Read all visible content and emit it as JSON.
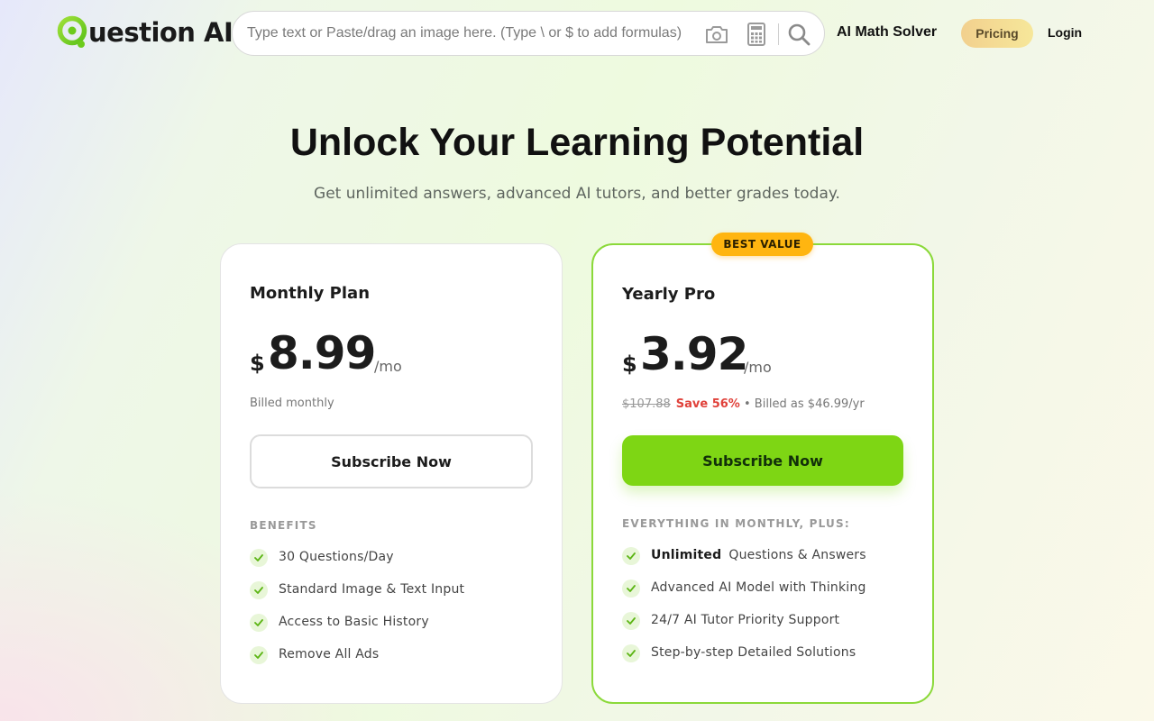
{
  "brand": {
    "logo_text": "uestion AI",
    "accent": "#7ed614"
  },
  "search": {
    "placeholder": "Type text or Paste/drag an image here. (Type \\ or $ to add formulas)",
    "icons": [
      "camera-icon",
      "calculator-icon",
      "search-icon"
    ]
  },
  "nav": {
    "solver": "AI Math Solver",
    "pricing": "Pricing",
    "login": "Login"
  },
  "hero": {
    "title": "Unlock Your Learning Potential",
    "subtitle": "Get unlimited answers, advanced AI tutors, and better grades today."
  },
  "plans": {
    "monthly": {
      "name": "Monthly Plan",
      "currency": "$",
      "amount": "8.99",
      "period": "/mo",
      "billed": "Billed monthly",
      "cta": "Subscribe Now",
      "features_heading": "BENEFITS",
      "features": [
        {
          "text": "30 Questions/Day"
        },
        {
          "text": "Standard Image & Text Input"
        },
        {
          "text": "Access to Basic History"
        },
        {
          "text": "Remove All Ads"
        }
      ]
    },
    "yearly": {
      "badge": "BEST VALUE",
      "name": "Yearly Pro",
      "currency": "$",
      "amount": "3.92",
      "period": "/mo",
      "original_price": "$107.88",
      "save": "Save 56%",
      "billed": "• Billed as $46.99/yr",
      "cta": "Subscribe Now",
      "features_heading": "EVERYTHING IN MONTHLY, PLUS:",
      "features": [
        {
          "bold": "Unlimited",
          "text": "Questions & Answers"
        },
        {
          "text": "Advanced AI Model with Thinking"
        },
        {
          "text": "24/7 AI Tutor Priority Support"
        },
        {
          "text": "Step-by-step Detailed Solutions"
        }
      ]
    }
  }
}
